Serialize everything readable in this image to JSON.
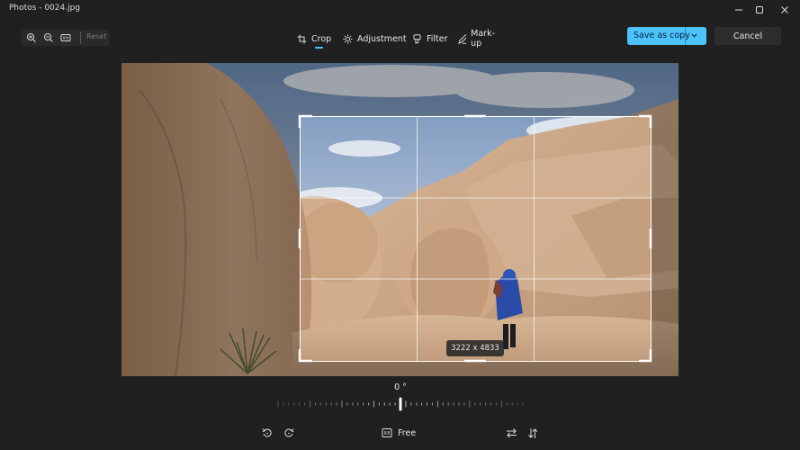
{
  "window": {
    "title": "Photos - 0024.jpg",
    "controls": [
      "minimize-icon",
      "maximize-icon",
      "close-icon"
    ]
  },
  "toolbar": {
    "zoom_in_icon": "zoom-in-icon",
    "zoom_out_icon": "zoom-out-icon",
    "actual_size_icon": "actual-size-icon",
    "reset_label": "Reset"
  },
  "tabs": [
    {
      "label": "Crop",
      "icon": "crop-icon",
      "active": true
    },
    {
      "label": "Adjustment",
      "icon": "brightness-icon",
      "active": false
    },
    {
      "label": "Filter",
      "icon": "filter-icon",
      "active": false
    },
    {
      "label": "Mark-up",
      "icon": "pen-icon",
      "active": false
    }
  ],
  "actions": {
    "save_label": "Save as copy",
    "cancel_label": "Cancel"
  },
  "crop": {
    "dimensions": "3222 x 4833"
  },
  "rotation": {
    "angle_label": "0 °",
    "angle_value": 0
  },
  "bottom": {
    "aspect_label": "Free",
    "icons": [
      "rotate-left-icon",
      "rotate-right-icon",
      "aspect-ratio-icon",
      "flip-horizontal-icon",
      "flip-vertical-icon"
    ]
  },
  "colors": {
    "accent": "#4cc2ff",
    "background": "#202020"
  }
}
